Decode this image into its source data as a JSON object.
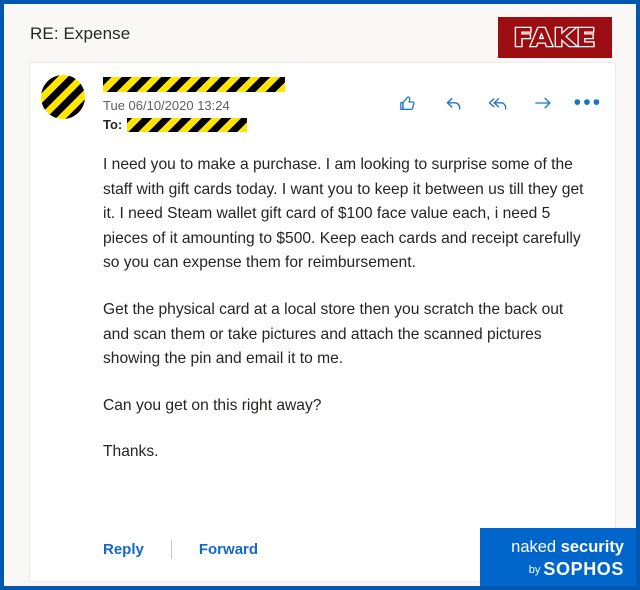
{
  "window": {
    "border_color": "#0057B0",
    "background": "#F9F8F7"
  },
  "header": {
    "subject": "RE: Expense",
    "badge": {
      "label": "FAKE",
      "background_color": "#9C0D11",
      "text_color": "#FFFFFF"
    }
  },
  "email": {
    "avatar": "redacted-avatar",
    "sender": "[redacted]",
    "date": "Tue 06/10/2020 13:24",
    "to_label": "To:",
    "to_value": "[redacted]",
    "actions": [
      {
        "name": "like",
        "label": "Like"
      },
      {
        "name": "reply",
        "label": "Reply"
      },
      {
        "name": "reply-all",
        "label": "Reply all"
      },
      {
        "name": "forward",
        "label": "Forward"
      },
      {
        "name": "more",
        "label": "More actions"
      }
    ],
    "body_paragraphs": [
      "I need you to make a purchase. I am looking to surprise some of the staff with gift cards today. I want you to keep it between us till they get it. I need Steam wallet gift card of $100 face value each, i need 5 pieces of it amounting to $500. Keep each cards and receipt carefully so you can expense them for reimbursement.",
      "Get the physical card at a local store then you scratch the back out and scan them or take pictures and attach the scanned pictures showing the pin and email it to me.",
      "Can you get on this right away?",
      "Thanks."
    ],
    "footer": {
      "reply_label": "Reply",
      "forward_label": "Forward",
      "link_color": "#1269C9"
    }
  },
  "watermark": {
    "line1_light": "naked ",
    "line1_bold": "security",
    "by": "by",
    "brand": "SOPHOS",
    "background_color": "#0066CC"
  }
}
